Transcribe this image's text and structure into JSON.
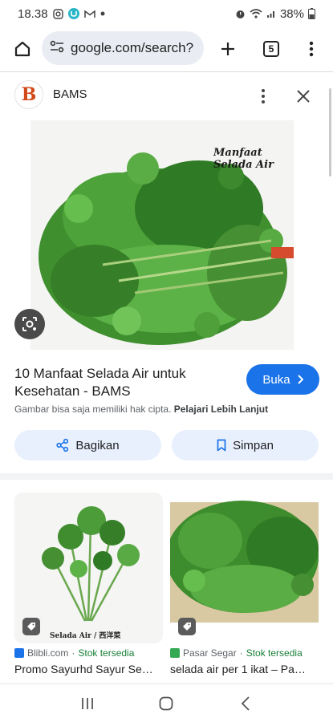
{
  "status_bar": {
    "time": "18.38",
    "battery": "38%"
  },
  "browser": {
    "url": "google.com/search?",
    "tab_count": "5"
  },
  "source": {
    "logo_letter": "B",
    "name": "BAMS"
  },
  "image": {
    "caption": "Manfaat Selada Air"
  },
  "result": {
    "title": "10 Manfaat Selada Air untuk Kesehatan - BAMS",
    "visit_label": "Buka",
    "disclaimer": "Gambar bisa saja memiliki hak cipta.",
    "learn_more": "Pelajari Lebih Lanjut",
    "share_label": "Bagikan",
    "save_label": "Simpan"
  },
  "related": [
    {
      "image_caption": "Selada Air / 西洋菜",
      "source": "Blibli.com",
      "stock": "Stok tersedia",
      "title": "Promo Sayurhd Sayur Se…",
      "favicon_color": "#1a73e8"
    },
    {
      "image_caption": "",
      "source": "Pasar Segar",
      "stock": "Stok tersedia",
      "title": "selada air per 1 ikat – Pa…",
      "favicon_color": "#34a853"
    }
  ],
  "colors": {
    "accent": "#1a73e8",
    "stock_green": "#188038"
  }
}
